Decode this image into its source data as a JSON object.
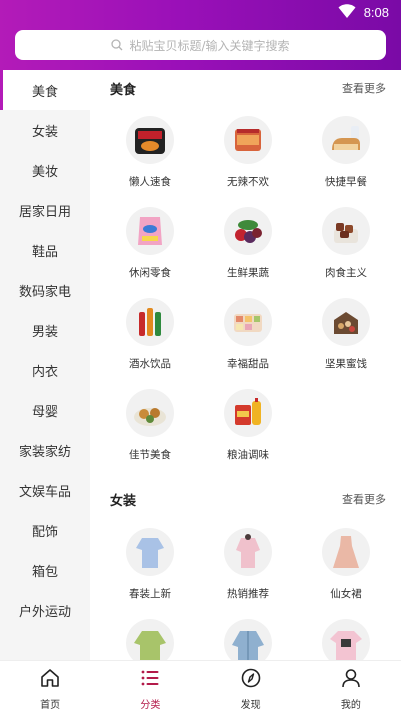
{
  "status": {
    "time": "8:08"
  },
  "search": {
    "placeholder": "粘贴宝贝标题/输入关键字搜索"
  },
  "sidebar": {
    "items": [
      {
        "label": "美食"
      },
      {
        "label": "女装"
      },
      {
        "label": "美妆"
      },
      {
        "label": "居家日用"
      },
      {
        "label": "鞋品"
      },
      {
        "label": "数码家电"
      },
      {
        "label": "男装"
      },
      {
        "label": "内衣"
      },
      {
        "label": "母婴"
      },
      {
        "label": "家装家纺"
      },
      {
        "label": "文娱车品"
      },
      {
        "label": "配饰"
      },
      {
        "label": "箱包"
      },
      {
        "label": "户外运动"
      }
    ]
  },
  "sections": [
    {
      "title": "美食",
      "more": "查看更多",
      "items": [
        {
          "label": "懒人速食",
          "icon": "instant-noodles-icon"
        },
        {
          "label": "无辣不欢",
          "icon": "spicy-snack-icon"
        },
        {
          "label": "快捷早餐",
          "icon": "bread-milk-icon"
        },
        {
          "label": "休闲零食",
          "icon": "chips-bag-icon"
        },
        {
          "label": "生鲜果蔬",
          "icon": "fruit-icon"
        },
        {
          "label": "肉食主义",
          "icon": "meat-jerky-icon"
        },
        {
          "label": "酒水饮品",
          "icon": "bottles-icon"
        },
        {
          "label": "幸福甜品",
          "icon": "dessert-box-icon"
        },
        {
          "label": "坚果蜜饯",
          "icon": "nuts-gift-box-icon"
        },
        {
          "label": "佳节美食",
          "icon": "mooncake-plate-icon"
        },
        {
          "label": "粮油调味",
          "icon": "rice-oil-icon"
        }
      ]
    },
    {
      "title": "女装",
      "more": "查看更多",
      "items": [
        {
          "label": "春装上新",
          "icon": "blouse-icon"
        },
        {
          "label": "热销推荐",
          "icon": "pink-outfit-icon"
        },
        {
          "label": "仙女裙",
          "icon": "dress-icon"
        },
        {
          "label": "",
          "icon": "green-sweater-icon"
        },
        {
          "label": "",
          "icon": "denim-jacket-icon"
        },
        {
          "label": "",
          "icon": "tshirt-icon"
        }
      ]
    }
  ],
  "tabbar": {
    "tabs": [
      {
        "label": "首页",
        "icon": "home-icon"
      },
      {
        "label": "分类",
        "icon": "list-icon"
      },
      {
        "label": "发现",
        "icon": "compass-icon"
      },
      {
        "label": "我的",
        "icon": "user-icon"
      }
    ]
  },
  "colors": {
    "accent": "#b31bb8",
    "tab_active": "#b31b4a",
    "sidebar_bg": "#f5f5f5"
  }
}
